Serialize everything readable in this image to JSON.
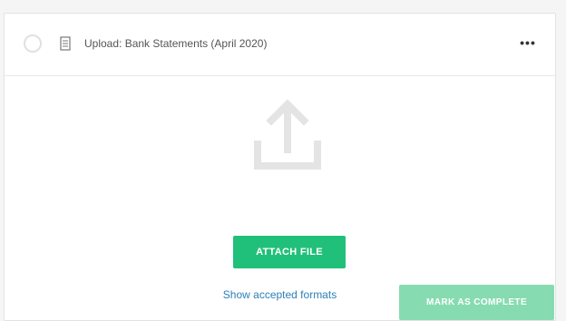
{
  "task": {
    "title": "Upload: Bank Statements (April 2020)",
    "menu_label": "•••"
  },
  "upload": {
    "attach_label": "ATTACH FILE",
    "formats_label": "Show accepted formats"
  },
  "actions": {
    "complete_label": "MARK AS COMPLETE"
  },
  "colors": {
    "accent": "#21c07a",
    "accent_disabled": "#86dcb0",
    "link": "#2c7fb8"
  },
  "icons": [
    "checkbox-circle-icon",
    "document-icon",
    "more-icon",
    "upload-icon"
  ]
}
